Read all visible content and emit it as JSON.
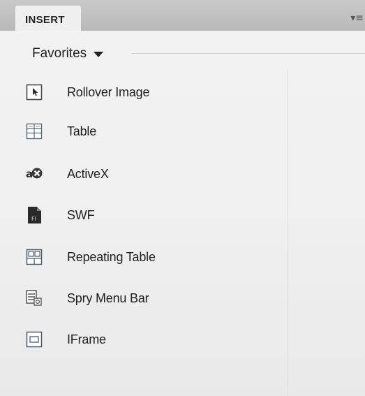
{
  "panel": {
    "tab_label": "INSERT",
    "menu_glyph": "▾≡"
  },
  "category": {
    "label": "Favorites",
    "dropdown_icon": "caret-down-icon"
  },
  "items": [
    {
      "label": "Rollover Image",
      "icon": "rollover-image-icon"
    },
    {
      "label": "Table",
      "icon": "table-icon"
    },
    {
      "label": "ActiveX",
      "icon": "activex-icon"
    },
    {
      "label": "SWF",
      "icon": "swf-icon"
    },
    {
      "label": "Repeating Table",
      "icon": "repeating-table-icon"
    },
    {
      "label": "Spry Menu Bar",
      "icon": "spry-menu-bar-icon"
    },
    {
      "label": "IFrame",
      "icon": "iframe-icon"
    }
  ]
}
